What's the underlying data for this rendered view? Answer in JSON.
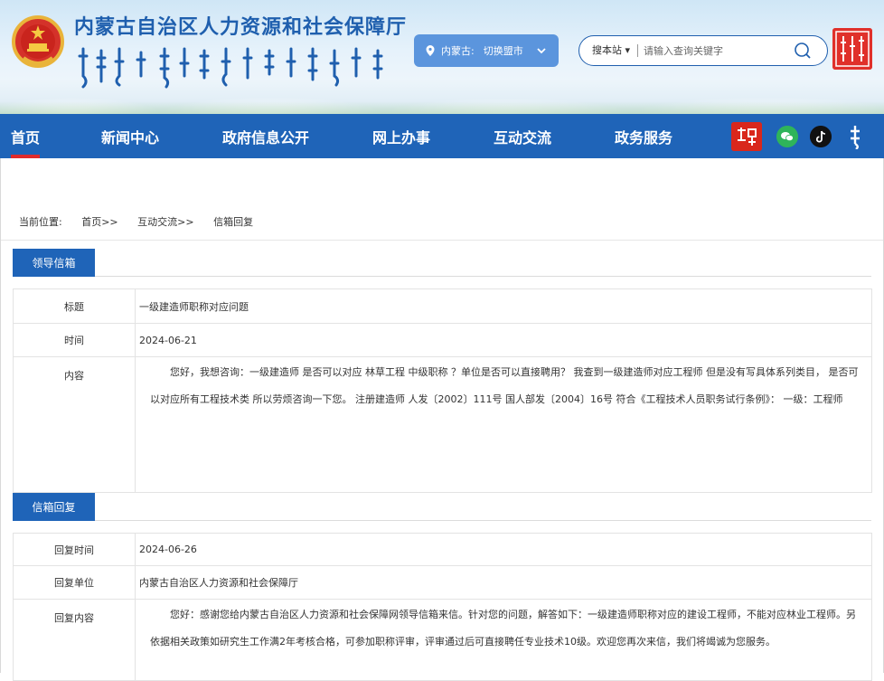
{
  "header": {
    "site_title": "内蒙古自治区人力资源和社会保障厅",
    "region": {
      "label": "内蒙古:",
      "action": "切换盟市"
    },
    "search": {
      "scope": "搜本站 ▾",
      "placeholder": "请输入查询关键字"
    }
  },
  "nav": {
    "items": [
      {
        "label": "首页"
      },
      {
        "label": "新闻中心"
      },
      {
        "label": "政府信息公开"
      },
      {
        "label": "网上办事"
      },
      {
        "label": "互动交流"
      },
      {
        "label": "政务服务"
      }
    ]
  },
  "breadcrumb": {
    "prefix": "当前位置:",
    "items": [
      "首页>>",
      "互动交流>>",
      "信箱回复"
    ]
  },
  "letter": {
    "section_title": "领导信箱",
    "title_label": "标题",
    "title_value": "一级建造师职称对应问题",
    "time_label": "时间",
    "time_value": "2024-06-21",
    "content_label": "内容",
    "content_value": "您好，我想咨询：一级建造师 是否可以对应 林草工程 中级职称  ？单位是否可以直接聘用？   我查到一级建造师对应工程师    但是没有写具体系列类目， 是否可以对应所有工程技术类    所以劳烦咨询一下您。 注册建造师 人发〔2002〕111号    国人部发〔2004〕16号 符合《工程技术人员职务试行条例》：   一级：工程师"
  },
  "reply": {
    "section_title": "信箱回复",
    "time_label": "回复时间",
    "time_value": "2024-06-26",
    "unit_label": "回复单位",
    "unit_value": "内蒙古自治区人力资源和社会保障厅",
    "content_label": "回复内容",
    "content_value": "您好：感谢您给内蒙古自治区人力资源和社会保障网领导信箱来信。针对您的问题，解答如下：一级建造师职称对应的建设工程师，不能对应林业工程师。另依据相关政策如研究生工作满2年考核合格，可参加职称评审，评审通过后可直接聘任专业技术10级。欢迎您再次来信，我们将竭诚为您服务。"
  },
  "colors": {
    "brand_blue": "#1f64b8",
    "title_blue": "#1f5fae",
    "active_red": "#e02b2b",
    "switch_blue": "#5b95dd"
  },
  "icons": [
    "national-emblem-icon",
    "location-pin-icon",
    "chevron-down-icon",
    "search-icon",
    "xuexi-qiangguo-icon",
    "wechat-icon",
    "tiktok-icon",
    "mongolian-script-icon"
  ]
}
